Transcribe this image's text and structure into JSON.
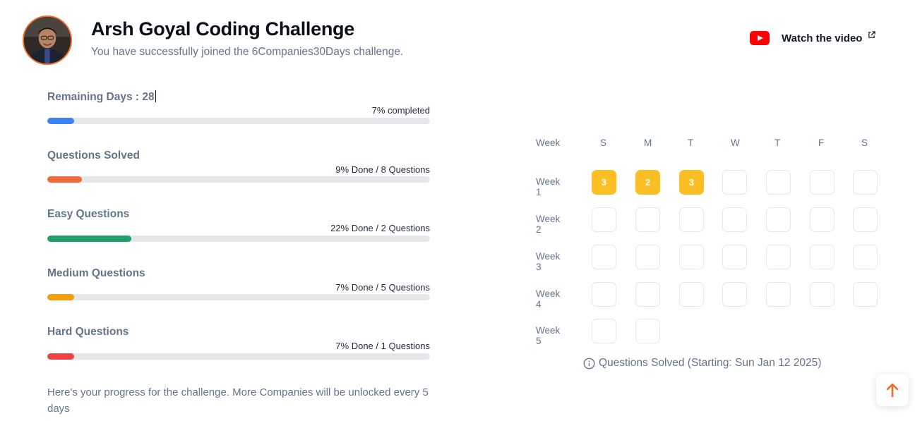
{
  "header": {
    "title": "Arsh Goyal Coding Challenge",
    "subtitle": "You have successfully joined the 6Companies30Days challenge.",
    "avatar_accent": "#f26b2a"
  },
  "video_link": {
    "label": "Watch the video",
    "icon": "youtube-icon",
    "external_icon": "external-link-icon"
  },
  "progress": {
    "remaining_days": {
      "label": "Remaining Days : 28",
      "status": "7% completed",
      "percent": 7,
      "color": "#3b82f6"
    },
    "questions_solved": {
      "label": "Questions Solved",
      "status": "9% Done / 8 Questions",
      "percent": 9,
      "color": "#f26b3a"
    },
    "easy": {
      "label": "Easy Questions",
      "status": "22% Done / 2 Questions",
      "percent": 22,
      "color": "#22a06b"
    },
    "medium": {
      "label": "Medium Questions",
      "status": "7% Done / 5 Questions",
      "percent": 7,
      "color": "#f59e0b"
    },
    "hard": {
      "label": "Hard Questions",
      "status": "7% Done / 1 Questions",
      "percent": 7,
      "color": "#ef4444"
    }
  },
  "footnote": "Here's your progress for the challenge. More Companies will be unlocked every 5 days",
  "calendar": {
    "week_header": "Week",
    "days": [
      "S",
      "M",
      "T",
      "W",
      "T",
      "F",
      "S"
    ],
    "weeks": [
      {
        "label": "Week 1",
        "cells": [
          "3",
          "2",
          "3",
          "",
          "",
          "",
          ""
        ]
      },
      {
        "label": "Week 2",
        "cells": [
          "",
          "",
          "",
          "",
          "",
          "",
          ""
        ]
      },
      {
        "label": "Week 3",
        "cells": [
          "",
          "",
          "",
          "",
          "",
          "",
          ""
        ]
      },
      {
        "label": "Week 4",
        "cells": [
          "",
          "",
          "",
          "",
          "",
          "",
          ""
        ]
      },
      {
        "label": "Week 5",
        "cells": [
          "",
          ""
        ]
      }
    ],
    "filled_color": "#fbbf24",
    "caption": "Questions Solved (Starting: Sun Jan 12 2025)"
  },
  "scroll_top": {
    "icon": "arrow-up-icon",
    "color": "#f26b2a"
  }
}
